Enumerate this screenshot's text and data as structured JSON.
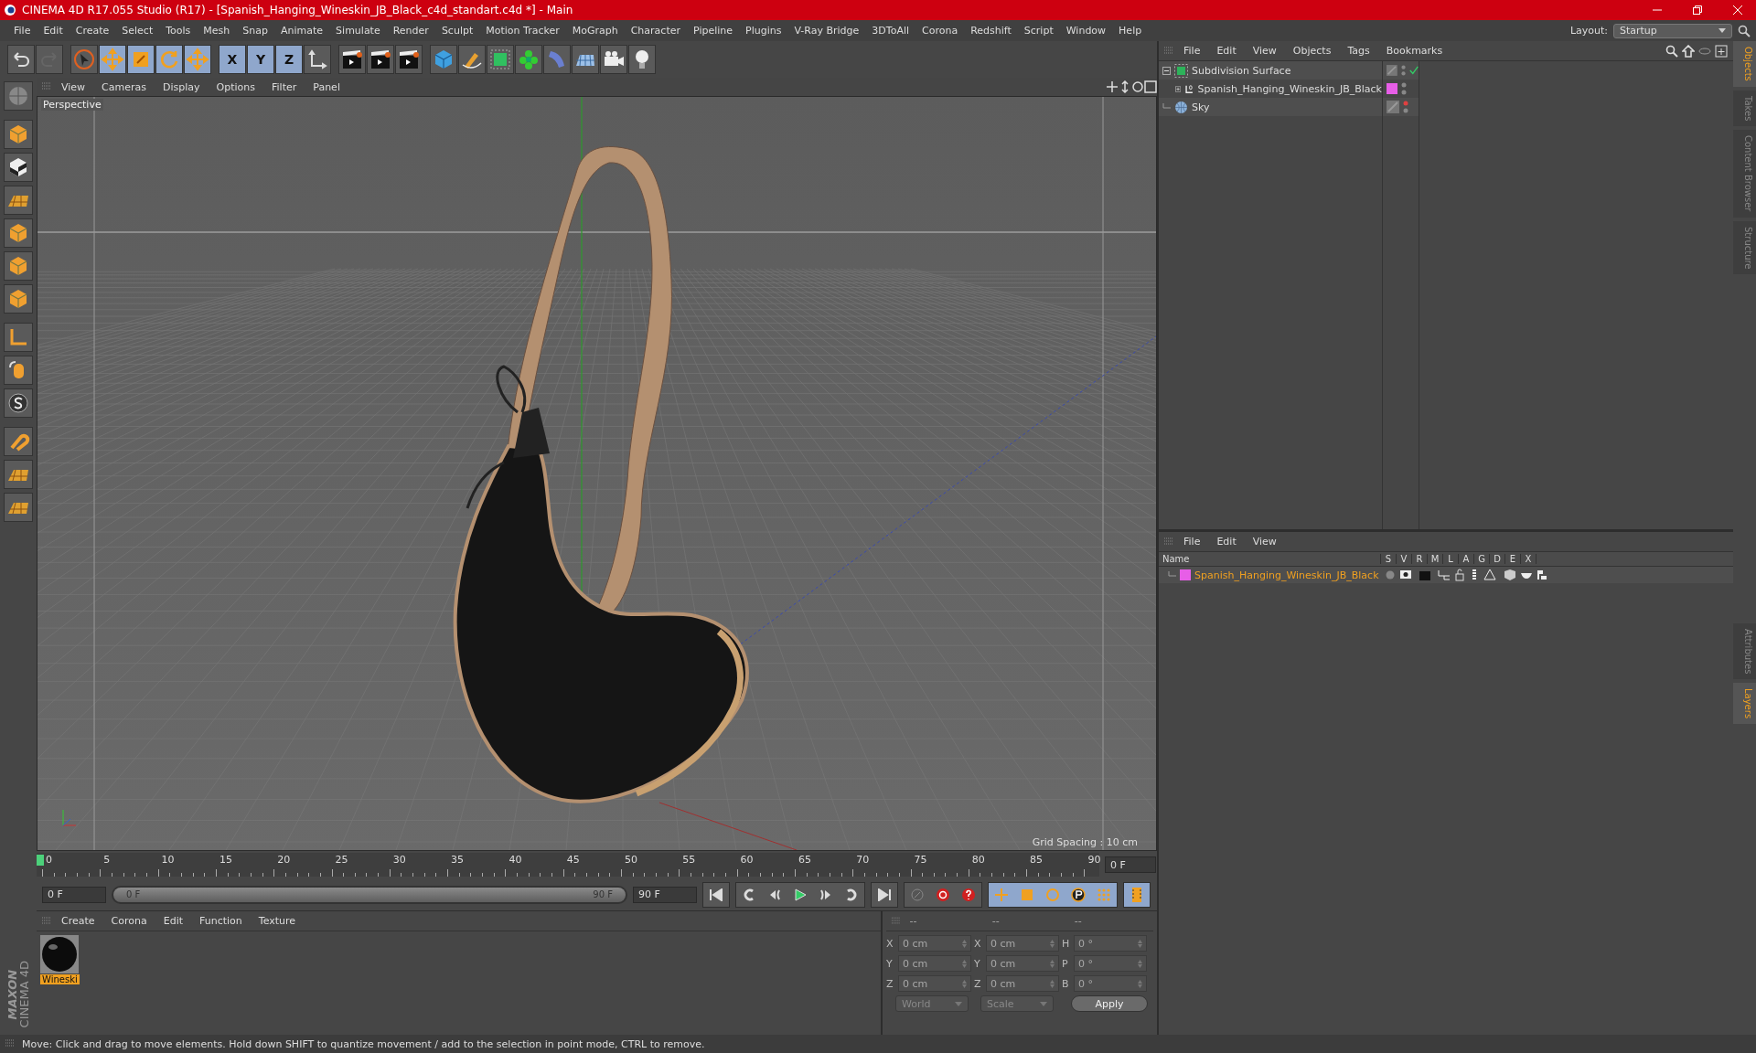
{
  "window": {
    "title": "CINEMA 4D R17.055 Studio (R17) - [Spanish_Hanging_Wineskin_JB_Black_c4d_standart.c4d *] - Main"
  },
  "menu": [
    "File",
    "Edit",
    "Create",
    "Select",
    "Tools",
    "Mesh",
    "Snap",
    "Animate",
    "Simulate",
    "Render",
    "Sculpt",
    "Motion Tracker",
    "MoGraph",
    "Character",
    "Pipeline",
    "Plugins",
    "V-Ray Bridge",
    "3DToAll",
    "Corona",
    "Redshift",
    "Script",
    "Window",
    "Help"
  ],
  "layout": {
    "label": "Layout:",
    "value": "Startup"
  },
  "toolbar": {
    "axis_buttons": [
      {
        "label": "X",
        "on": true
      },
      {
        "label": "Y",
        "on": true
      },
      {
        "label": "Z",
        "on": true
      }
    ]
  },
  "viewport": {
    "menu": [
      "View",
      "Cameras",
      "Display",
      "Options",
      "Filter",
      "Panel"
    ],
    "camera": "Perspective",
    "grid_spacing": "Grid Spacing : 10 cm"
  },
  "object_manager": {
    "menu": [
      "File",
      "Edit",
      "View",
      "Objects",
      "Tags",
      "Bookmarks"
    ],
    "objects": [
      {
        "name": "Subdivision Surface",
        "kind": "subdivision",
        "expanded": true,
        "editor_visible": true,
        "enabled": true,
        "children": [
          {
            "name": "Spanish_Hanging_Wineskin_JB_Black",
            "kind": "polygon",
            "expanded": false,
            "editor_visible": true,
            "color": "#e75ee7"
          }
        ]
      },
      {
        "name": "Sky",
        "kind": "sky",
        "editor_visible": false
      }
    ]
  },
  "side_tabs_top": [
    {
      "label": "Objects",
      "selected": true
    },
    {
      "label": "Takes",
      "selected": false
    },
    {
      "label": "Content Browser",
      "selected": false
    },
    {
      "label": "Structure",
      "selected": false
    }
  ],
  "side_tabs_bottom": [
    {
      "label": "Attributes",
      "selected": false
    },
    {
      "label": "Layers",
      "selected": true
    }
  ],
  "layer_manager": {
    "menu": [
      "File",
      "Edit",
      "View"
    ],
    "columns": [
      "Name",
      "S",
      "V",
      "R",
      "M",
      "L",
      "A",
      "G",
      "D",
      "E",
      "X"
    ],
    "layers": [
      {
        "name": "Spanish_Hanging_Wineskin_JB_Black",
        "color": "#e75ee7"
      }
    ]
  },
  "timeline": {
    "ticks": [
      "0",
      "5",
      "10",
      "15",
      "20",
      "25",
      "30",
      "35",
      "40",
      "45",
      "50",
      "55",
      "60",
      "65",
      "70",
      "75",
      "80",
      "85",
      "90"
    ],
    "current_field": "0 F",
    "start_field": "0 F",
    "range_start": "0 F",
    "range_end": "90 F",
    "level": 1,
    "end_field": "90 F"
  },
  "material_manager": {
    "menu": [
      "Create",
      "Corona",
      "Edit",
      "Function",
      "Texture"
    ],
    "materials": [
      {
        "name": "Wineski",
        "selected": true
      }
    ]
  },
  "coordinates": {
    "headers": [
      "--",
      "--",
      "--"
    ],
    "rows": [
      [
        {
          "label": "X",
          "value": "0 cm"
        },
        {
          "label": "X",
          "value": "0 cm"
        },
        {
          "label": "H",
          "value": "0 °"
        }
      ],
      [
        {
          "label": "Y",
          "value": "0 cm"
        },
        {
          "label": "Y",
          "value": "0 cm"
        },
        {
          "label": "P",
          "value": "0 °"
        }
      ],
      [
        {
          "label": "Z",
          "value": "0 cm"
        },
        {
          "label": "Z",
          "value": "0 cm"
        },
        {
          "label": "B",
          "value": "0 °"
        }
      ]
    ],
    "mode": "World",
    "transform": "Scale",
    "apply": "Apply"
  },
  "brand": {
    "top": "MAXON",
    "bottom": "CINEMA 4D"
  },
  "status_bar": "Move: Click and drag to move elements. Hold down SHIFT to quantize movement / add to the selection in point mode, CTRL to remove."
}
